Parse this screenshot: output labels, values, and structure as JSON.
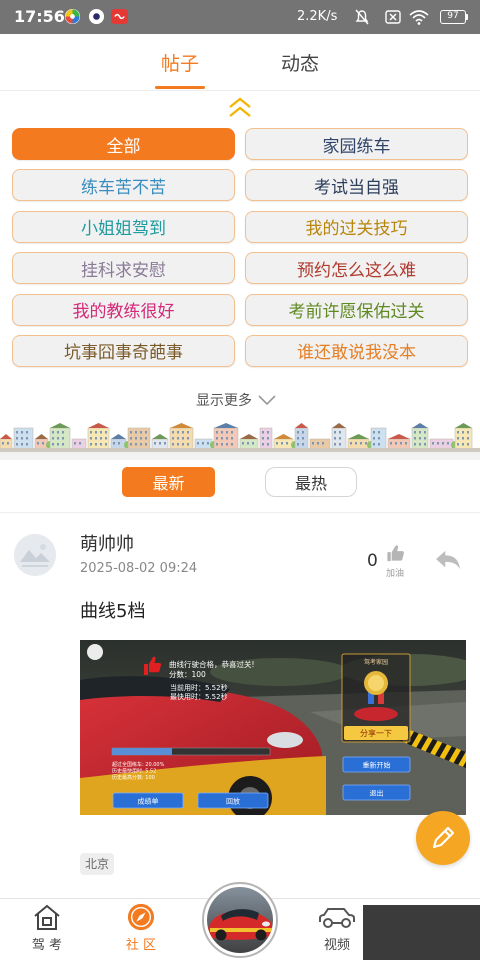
{
  "status_bar": {
    "time": "17:56",
    "net_speed": "2.2K/s",
    "battery": "97",
    "background": "#747474"
  },
  "theme": {
    "accent": "#f47a1f",
    "fab": "#f5a623",
    "collapse_icon": "#f2b705"
  },
  "tabs": [
    {
      "label": "帖子",
      "active": true
    },
    {
      "label": "动态",
      "active": false
    }
  ],
  "categories": [
    {
      "label": "全部",
      "color": "#ffffff",
      "active": true
    },
    {
      "label": "家园练车",
      "color": "#2f4468",
      "active": false
    },
    {
      "label": "练车苦不苦",
      "color": "#3a8dbf",
      "active": false
    },
    {
      "label": "考试当自强",
      "color": "#2c3e5c",
      "active": false
    },
    {
      "label": "小姐姐驾到",
      "color": "#1f9a9e",
      "active": false
    },
    {
      "label": "我的过关技巧",
      "color": "#b8860b",
      "active": false
    },
    {
      "label": "挂科求安慰",
      "color": "#8a7a96",
      "active": false
    },
    {
      "label": "预约怎么这么难",
      "color": "#b03a2e",
      "active": false
    },
    {
      "label": "我的教练很好",
      "color": "#d42a78",
      "active": false
    },
    {
      "label": "考前许愿保佑过关",
      "color": "#5f8a22",
      "active": false
    },
    {
      "label": "坑事囧事奇葩事",
      "color": "#7b5a2a",
      "active": false
    },
    {
      "label": "谁还敢说我没本",
      "color": "#e67e22",
      "active": false
    }
  ],
  "show_more": "显示更多",
  "sort": [
    {
      "label": "最新",
      "active": true
    },
    {
      "label": "最热",
      "active": false
    }
  ],
  "post": {
    "author": "萌帅帅",
    "time": "2025-08-02 09:24",
    "like_count": "0",
    "like_label": "加油",
    "title": "曲线5档",
    "location": "北京",
    "image": {
      "result_message": "曲线行驶合格，恭喜过关!",
      "score": "分数：100",
      "current_time": "当前用时：5.52秒",
      "best_time": "最快用时：5.52秒",
      "brand": "驾考家园",
      "share_button": "分享一下",
      "restart_button": "重新开始",
      "exit_button": "退出",
      "report_button": "成绩单",
      "replay_button": "回放",
      "stats": [
        "超过全国练车: 20.00%",
        "历史最快用时: 5.52",
        "历史最高分数: 100"
      ]
    }
  },
  "bottom_nav": {
    "items": [
      {
        "label": "驾 考",
        "icon": "house-icon",
        "active": false
      },
      {
        "label": "社 区",
        "icon": "compass-icon",
        "active": true
      },
      {
        "label": "视频",
        "icon": "car-icon",
        "active": false
      }
    ],
    "center_icon": "car-badge-icon"
  }
}
